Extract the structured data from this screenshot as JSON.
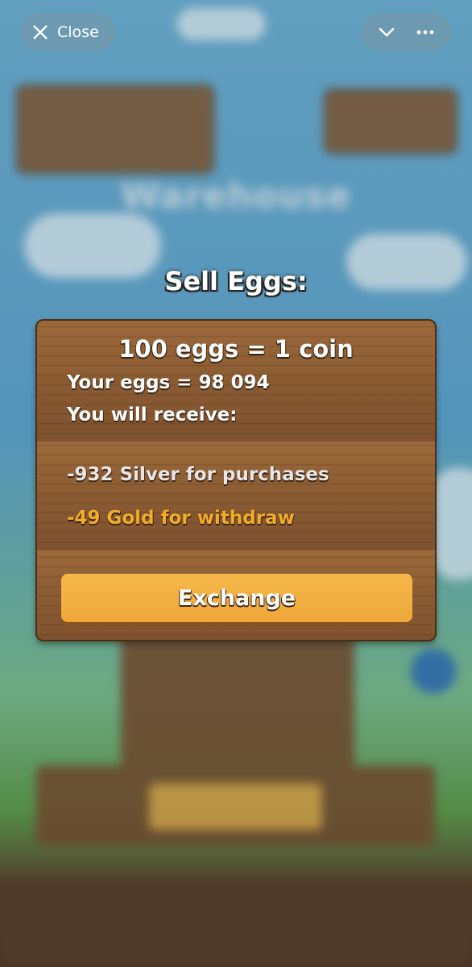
{
  "header": {
    "close_label": "Close"
  },
  "dialog": {
    "title": "Sell Eggs:",
    "rate": "100 eggs = 1 coin",
    "your_eggs": "Your eggs = 98 094",
    "receive_label": "You will receive:",
    "silver": "-932 Silver for purchases",
    "gold": "-49 Gold for withdraw",
    "exchange_label": "Exchange"
  },
  "colors": {
    "gold_text": "#f1ad2a",
    "button": "#eea73a",
    "wood": "#8b5a31"
  }
}
